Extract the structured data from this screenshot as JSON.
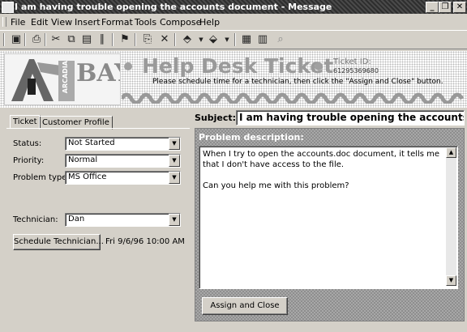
{
  "window": {
    "title": "I am having trouble opening the accounts document - Message",
    "controls": [
      "_",
      "❐",
      "✕"
    ]
  },
  "menu": [
    "File",
    "Edit",
    "View",
    "Insert",
    "Format",
    "Tools",
    "Compose",
    "Help"
  ],
  "banner": {
    "logo_text": "BAY",
    "logo_small": "ARCADIA",
    "title": "Help Desk Ticket",
    "ticket_id_label": "Ticket ID:",
    "ticket_id_value": "61295369680",
    "instruction": "Please schedule time for a technician, then click the \"Assign and Close\" button."
  },
  "tabs": [
    "Ticket",
    "Customer Profile"
  ],
  "form": {
    "status_label": "Status:",
    "status_value": "Not Started",
    "priority_label": "Priority:",
    "priority_value": "Normal",
    "problem_type_label": "Problem type:",
    "problem_type_value": "MS Office",
    "technician_label": "Technician:",
    "technician_value": "Dan",
    "schedule_button": "Schedule Technician...",
    "schedule_datetime": "Fri 9/6/96 10:00 AM"
  },
  "subject": {
    "label": "Subject:",
    "value": "I am having trouble opening the accounts"
  },
  "problem": {
    "label": "Problem description:",
    "line1": "When I try to open the accounts.doc document, it tells me that I don't have access to the file.",
    "line2": "Can you help me with this problem?"
  },
  "assign_button": "Assign and Close"
}
